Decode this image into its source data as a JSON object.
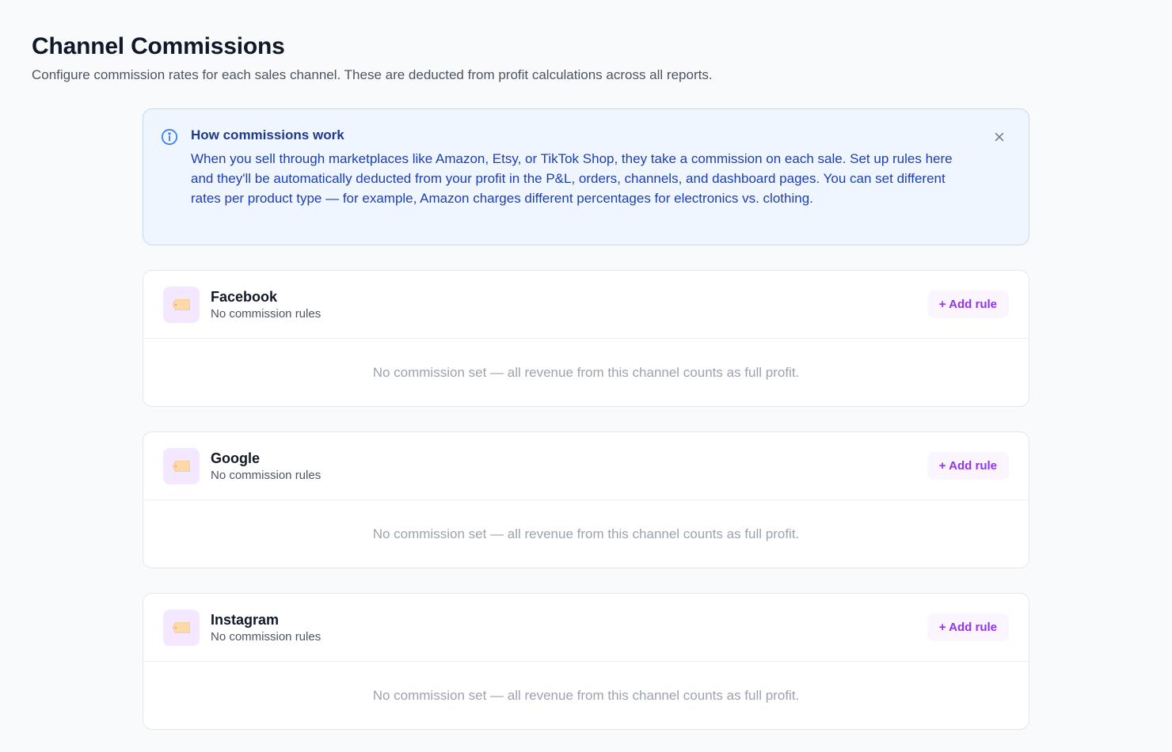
{
  "page": {
    "title": "Channel Commissions",
    "subtitle": "Configure commission rates for each sales channel. These are deducted from profit calculations across all reports."
  },
  "info": {
    "title": "How commissions work",
    "body": "When you sell through marketplaces like Amazon, Etsy, or TikTok Shop, they take a commission on each sale. Set up rules here and they'll be automatically deducted from your profit in the P&L, orders, channels, and dashboard pages. You can set different rates per product type — for example, Amazon charges different percentages for electronics vs. clothing.",
    "icon": "info-icon",
    "close_icon": "close-icon"
  },
  "channels": [
    {
      "name": "Facebook",
      "status": "No commission rules",
      "add_label": "+ Add rule",
      "empty_message": "No commission set — all revenue from this channel counts as full profit.",
      "icon": "tag-icon"
    },
    {
      "name": "Google",
      "status": "No commission rules",
      "add_label": "+ Add rule",
      "empty_message": "No commission set — all revenue from this channel counts as full profit.",
      "icon": "tag-icon"
    },
    {
      "name": "Instagram",
      "status": "No commission rules",
      "add_label": "+ Add rule",
      "empty_message": "No commission set — all revenue from this channel counts as full profit.",
      "icon": "tag-icon"
    }
  ],
  "colors": {
    "accent": "#9333ea",
    "info_bg": "#eff6ff",
    "info_text": "#1e40af",
    "tag_fill": "#fcd9a8"
  }
}
